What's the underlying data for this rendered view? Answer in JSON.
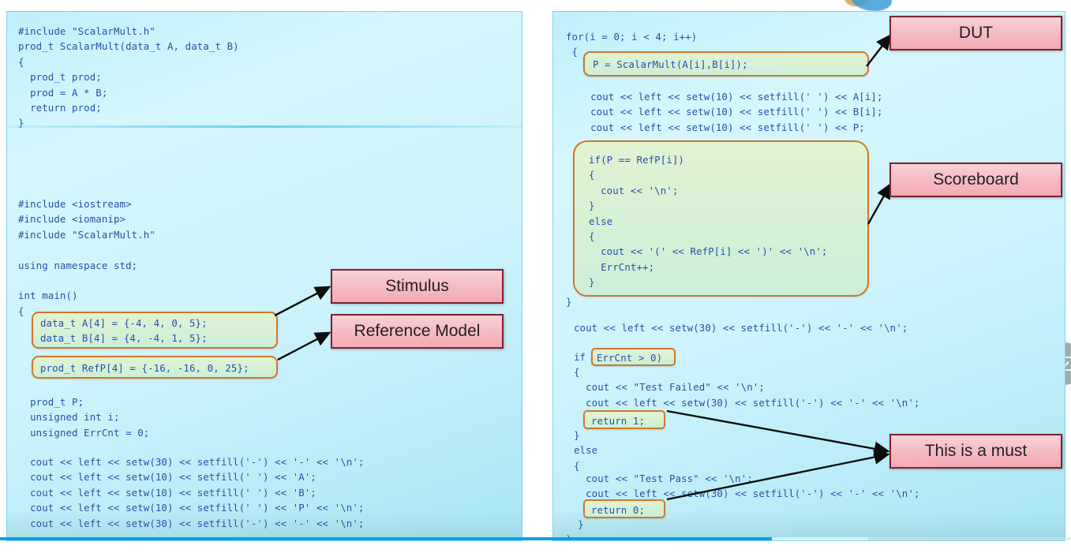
{
  "player": {
    "logo_icon": "channel-logo",
    "side_control_icon": "collapse-chevron-icon",
    "progress_percent": 72,
    "buffered_percent": 81
  },
  "left_panel": {
    "header_code": "#include \"ScalarMult.h\"\nprod_t ScalarMult(data_t A, data_t B)\n{\n  prod_t prod;\n  prod = A * B;\n  return prod;\n}",
    "includes_code": "#include <iostream>\n#include <iomanip>\n#include \"ScalarMult.h\"\n\nusing namespace std;\n\nint main()\n{",
    "stimulus_code": "data_t A[4] = {-4, 4, 0, 5};\ndata_t B[4] = {4, -4, 1, 5};",
    "refmodel_code": "prod_t RefP[4] = {-16, -16, 0, 25};",
    "decls_code": "  prod_t P;\n  unsigned int i;\n  unsigned ErrCnt = 0;",
    "print_code": "  cout << left << setw(30) << setfill('-') << '-' << '\\n';\n  cout << left << setw(10) << setfill(' ') << 'A';\n  cout << left << setw(10) << setfill(' ') << 'B';\n  cout << left << setw(10) << setfill(' ') << 'P' << '\\n';\n  cout << left << setw(30) << setfill('-') << '-' << '\\n';"
  },
  "right_panel": {
    "for_header_code": "for(i = 0; i < 4; i++)\n {",
    "dut_code": "P = ScalarMult(A[i],B[i]);",
    "print_loop_code": "  cout << left << setw(10) << setfill(' ') << A[i];\n  cout << left << setw(10) << setfill(' ') << B[i];\n  cout << left << setw(10) << setfill(' ') << P;",
    "scoreboard_code": "if(P == RefP[i])\n{\n  cout << '\\n';\n}\nelse\n{\n  cout << '(' << RefP[i] << ')' << '\\n';\n  ErrCnt++;\n}",
    "for_close_code": "}",
    "separator_code": "cout << left << setw(30) << setfill('-') << '-' << '\\n';",
    "if_keyword": "if",
    "if_condition": "ErrCnt > 0)",
    "fail_block_code": "{\n  cout << \"Test Failed\" << '\\n';\n  cout << left << setw(30) << setfill('-') << '-' << '\\n';",
    "return_one": "return 1;",
    "fail_close_code": "}\nelse\n{",
    "pass_block_code": "  cout << \"Test Pass\" << '\\n';\n  cout << left << setw(30) << setfill('-') << '-' << '\\n';",
    "return_zero": "return 0;",
    "pass_close_code": "  }\n}"
  },
  "callouts": [
    {
      "id": "stimulus",
      "label": "Stimulus"
    },
    {
      "id": "reference-model",
      "label": "Reference Model"
    },
    {
      "id": "dut",
      "label": "DUT"
    },
    {
      "id": "scoreboard",
      "label": "Scoreboard"
    },
    {
      "id": "this-is-a-must",
      "label": "This is a must"
    }
  ],
  "colors": {
    "panel_bg": "#cdf3fc",
    "panel_border": "#7fd4e8",
    "code_text": "#1f4fa8",
    "highlight_border": "#d2772a",
    "highlight_fill": "#dcf0cd",
    "callout_fill": "#f6bcc4",
    "callout_border": "#7e2230",
    "progress_accent": "#0aa3e0"
  }
}
